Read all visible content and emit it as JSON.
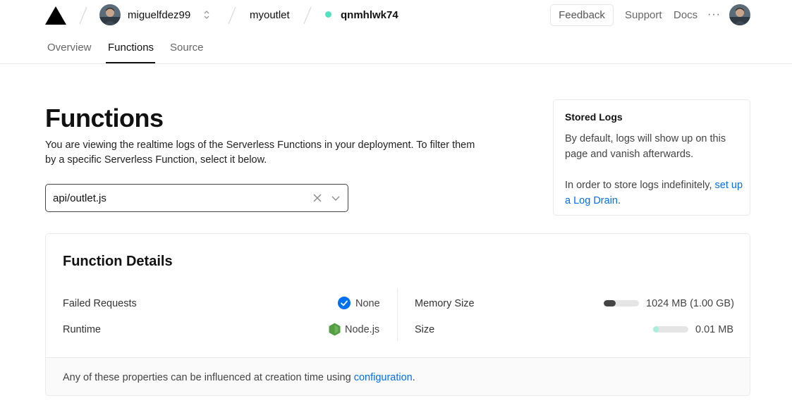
{
  "header": {
    "user": {
      "name": "miguelfdez99"
    },
    "project": "myoutlet",
    "deployment": {
      "id": "qnmhlwk74",
      "status_color": "#50e3c2"
    },
    "actions": {
      "feedback": "Feedback",
      "support": "Support",
      "docs": "Docs",
      "more": "···"
    }
  },
  "tabs": [
    {
      "label": "Overview",
      "active": false
    },
    {
      "label": "Functions",
      "active": true
    },
    {
      "label": "Source",
      "active": false
    }
  ],
  "main": {
    "title": "Functions",
    "description": "You are viewing the realtime logs of the Serverless Functions in your deployment. To filter them by a specific Serverless Function, select it below.",
    "function_select": {
      "value": "api/outlet.js"
    }
  },
  "stored_logs": {
    "title": "Stored Logs",
    "p1": "By default, logs will show up on this page and vanish afterwards.",
    "p2_prefix": "In order to store logs indefinitely, ",
    "p2_link": "set up a Log Drain",
    "p2_suffix": "."
  },
  "function_details": {
    "title": "Function Details",
    "failed_requests": {
      "label": "Failed Requests",
      "value": "None"
    },
    "runtime": {
      "label": "Runtime",
      "value": "Node.js"
    },
    "memory_size": {
      "label": "Memory Size",
      "value": "1024 MB (1.00 GB)",
      "fill_fraction": 0.33,
      "bar_color": "#444444"
    },
    "size": {
      "label": "Size",
      "value": "0.01 MB",
      "fill_fraction": 0.15,
      "bar_color": "#a8f0dc"
    },
    "footer_prefix": "Any of these properties can be influenced at creation time using ",
    "footer_link": "configuration",
    "footer_suffix": "."
  },
  "colors": {
    "link": "#0070f3",
    "check": "#0070f3",
    "node": "#539e43"
  },
  "icons": {
    "logo": "vercel-triangle-logo",
    "avatar": "user-avatar",
    "switcher": "chevron-up-down-icon",
    "clear": "close-icon",
    "dropdown": "chevron-down-icon",
    "check": "check-circle-icon",
    "runtime": "nodejs-hexagon-icon"
  }
}
